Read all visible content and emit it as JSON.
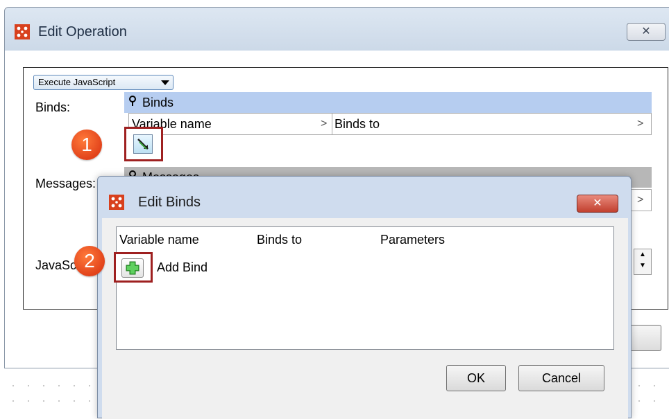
{
  "main_window": {
    "title": "Edit Operation",
    "close_glyph": "✕",
    "operation_type": "Execute JavaScript",
    "binds_label": "Binds:",
    "binds_table": {
      "header": "Binds",
      "columns": [
        "Variable name",
        "Binds to"
      ]
    },
    "messages_label": "Messages:",
    "messages_table": {
      "header": "Messages"
    },
    "javascript_label": "JavaScript:",
    "callout_1": "1"
  },
  "edit_binds_dialog": {
    "title": "Edit Binds",
    "close_glyph": "✕",
    "columns": [
      "Variable name",
      "Binds to",
      "Parameters"
    ],
    "add_bind_label": "Add Bind",
    "callout_2": "2",
    "ok_label": "OK",
    "cancel_label": "Cancel"
  },
  "colors": {
    "callout": "#e2431b",
    "highlight_border": "#9e2020",
    "binds_header": "#b6cdf0",
    "messages_header": "#b7b7b7",
    "app_icon": "#d8401d"
  },
  "icons": {
    "app": "app-grid-icon",
    "pin": "pin-icon",
    "edit": "edit-pencil-icon",
    "add": "green-plus-icon"
  }
}
